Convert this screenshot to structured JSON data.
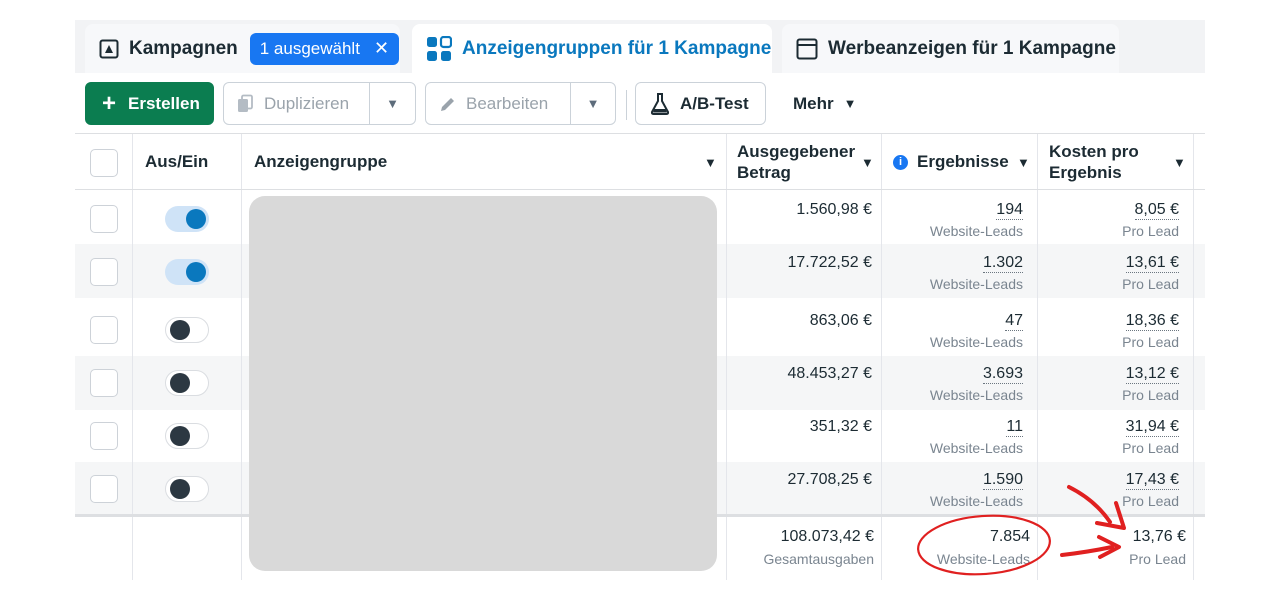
{
  "tabs": {
    "campaigns": {
      "label": "Kampagnen",
      "badge": "1 ausgewählt",
      "badge_close": "✕",
      "icon": "flag-icon"
    },
    "adsets": {
      "label": "Anzeigengruppen für 1 Kampagne",
      "icon": "grid-icon"
    },
    "ads": {
      "label": "Werbeanzeigen für 1 Kampagne",
      "icon": "window-icon"
    }
  },
  "toolbar": {
    "create": "Erstellen",
    "create_icon": "+",
    "duplicate": "Duplizieren",
    "edit": "Bearbeiten",
    "abtest": "A/B-Test",
    "more": "Mehr",
    "caret": "▼"
  },
  "table": {
    "headers": {
      "toggle": "Aus/Ein",
      "name": "Anzeigengruppe",
      "spent_line1": "Ausgegebener",
      "spent_line2": "Betrag",
      "results": "Ergebnisse",
      "results_info": "i",
      "cost_line1": "Kosten pro",
      "cost_line2": "Ergebnis"
    },
    "rows": [
      {
        "on": true,
        "spent": "1.560,98 €",
        "results": "194",
        "results_type": "Website-Leads",
        "cost": "8,05 €",
        "cost_type": "Pro Lead"
      },
      {
        "on": true,
        "spent": "17.722,52 €",
        "results": "1.302",
        "results_type": "Website-Leads",
        "cost": "13,61 €",
        "cost_type": "Pro Lead"
      },
      {
        "on": false,
        "spent": "863,06 €",
        "results": "47",
        "results_type": "Website-Leads",
        "cost": "18,36 €",
        "cost_type": "Pro Lead"
      },
      {
        "on": false,
        "spent": "48.453,27 €",
        "results": "3.693",
        "results_type": "Website-Leads",
        "cost": "13,12 €",
        "cost_type": "Pro Lead"
      },
      {
        "on": false,
        "spent": "351,32 €",
        "results": "11",
        "results_type": "Website-Leads",
        "cost": "31,94 €",
        "cost_type": "Pro Lead"
      },
      {
        "on": false,
        "spent": "27.708,25 €",
        "results": "1.590",
        "results_type": "Website-Leads",
        "cost": "17,43 €",
        "cost_type": "Pro Lead"
      }
    ],
    "totals": {
      "spent": "108.073,42 €",
      "spent_label": "Gesamtausgaben",
      "results": "7.854",
      "results_label": "Website-Leads",
      "cost": "13,76 €",
      "cost_label": "Pro Lead"
    }
  },
  "colors": {
    "accent": "#0a78be",
    "create_button": "#0b7d50",
    "annotation": "#e02020"
  }
}
